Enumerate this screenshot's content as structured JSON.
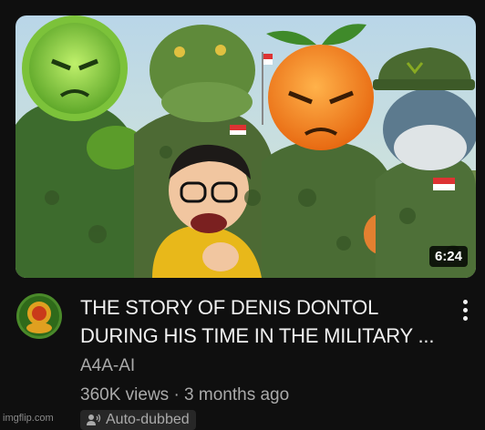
{
  "video": {
    "duration": "6:24",
    "title_line1": "THE STORY OF DENIS DONTOL",
    "title_line2": "DURING HIS TIME IN THE MILITARY ...",
    "channel": "A4A-AI",
    "meta": "360K views · 3 months ago",
    "badge": "Auto-dubbed"
  },
  "watermark": "imgflip.com",
  "icons": {
    "more": "more-vert-icon",
    "dub": "dubbing-icon",
    "avatar": "channel-avatar"
  },
  "colors": {
    "background": "#0f0f0f",
    "primary_text": "#f1f1f1",
    "secondary_text": "#aaaaaa",
    "badge_bg": "#272727"
  }
}
